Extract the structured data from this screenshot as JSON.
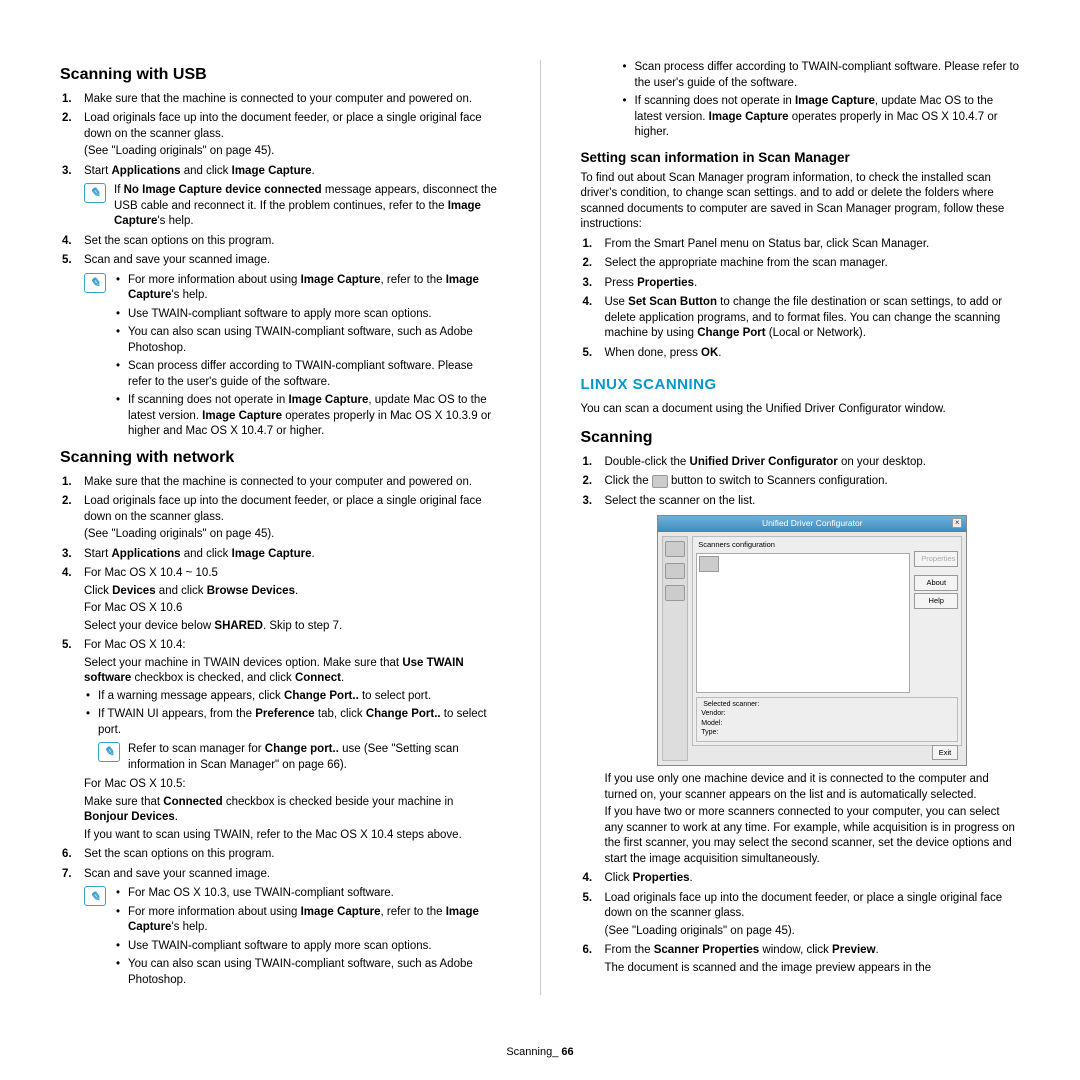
{
  "footer": {
    "label": "Scanning_",
    "page": "66"
  },
  "col1": {
    "h_usb": "Scanning with USB",
    "usb": {
      "s1": "Make sure that the machine is connected to your computer and powered on.",
      "s2a": "Load originals face up into the document feeder, or place a single original face down on the scanner glass.",
      "s2b": "(See \"Loading originals\" on page 45).",
      "s3_pre": "Start ",
      "s3_b1": "Applications",
      "s3_mid": " and click ",
      "s3_b2": "Image Capture",
      "s3_post": ".",
      "s3_note_pre": "If ",
      "s3_note_b1": "No Image Capture device connected",
      "s3_note_mid": " message appears, disconnect the USB cable and reconnect it. If the problem continues, refer to the ",
      "s3_note_b2": "Image Capture",
      "s3_note_post": "'s help.",
      "s4": "Set the scan options on this program.",
      "s5": "Scan and save your scanned image.",
      "nb1_pre": "For more information about using ",
      "nb1_b1": "Image Capture",
      "nb1_mid": ", refer to the ",
      "nb1_b2": "Image Capture",
      "nb1_post": "'s help.",
      "nb2": "Use TWAIN-compliant software to apply more scan options.",
      "nb3": "You can also scan using TWAIN-compliant software, such as Adobe Photoshop.",
      "nb4": "Scan process differ according to TWAIN-compliant software. Please refer to the user's guide of the software.",
      "nb5_pre": "If scanning does not operate in ",
      "nb5_b1": "Image Capture",
      "nb5_mid": ", update Mac OS to the latest version. ",
      "nb5_b2": "Image Capture",
      "nb5_post": " operates properly in Mac OS X 10.3.9 or higher and Mac OS X 10.4.7 or higher."
    },
    "h_net": "Scanning with network",
    "net": {
      "s1": "Make sure that the machine is connected to your computer and powered on.",
      "s2a": "Load originals face up into the document feeder, or place a single original face down on the scanner glass.",
      "s2b": "(See \"Loading originals\" on page 45).",
      "s3_pre": "Start ",
      "s3_b1": "Applications",
      "s3_mid": " and click ",
      "s3_b2": "Image Capture",
      "s3_post": ".",
      "s4a": "For Mac OS X 10.4 ~ 10.5",
      "s4b_pre": "Click ",
      "s4b_b1": "Devices",
      "s4b_mid": " and click ",
      "s4b_b2": "Browse Devices",
      "s4b_post": ".",
      "s4c": "For Mac OS X 10.6",
      "s4d_pre": "Select your device below ",
      "s4d_b": "SHARED",
      "s4d_post": ". Skip to step 7.",
      "s5a": "For Mac OS X 10.4:",
      "s5b_pre": "Select your machine in TWAIN devices option. Make sure that ",
      "s5b_b1": "Use TWAIN software",
      "s5b_mid": " checkbox is checked, and click ",
      "s5b_b2": "Connect",
      "s5b_post": ".",
      "s5_bul1_pre": "If a warning message appears, click ",
      "s5_bul1_b": "Change Port..",
      "s5_bul1_post": " to select port.",
      "s5_bul2_pre": "If TWAIN UI appears, from the ",
      "s5_bul2_b1": "Preference",
      "s5_bul2_mid": " tab, click ",
      "s5_bul2_b2": "Change Port..",
      "s5_bul2_post": " to select port.",
      "s5_note_pre": "Refer to scan manager for ",
      "s5_note_b": "Change port..",
      "s5_note_post": " use (See \"Setting scan information in Scan Manager\" on page 66).",
      "s5c": "For Mac OS X 10.5:",
      "s5d_pre": "Make sure that ",
      "s5d_b1": "Connected",
      "s5d_mid": " checkbox is checked beside your machine in ",
      "s5d_b2": "Bonjour Devices",
      "s5d_post": ".",
      "s5e": "If you want to scan using TWAIN, refer to the Mac OS X 10.4 steps above.",
      "s6": "Set the scan options on this program.",
      "s7": "Scan and save your scanned image.",
      "nb0": "For Mac OS X 10.3, use TWAIN-compliant software.",
      "nb1_pre": "For more information about using ",
      "nb1_b1": "Image Capture",
      "nb1_mid": ", refer to the ",
      "nb1_b2": "Image Capture",
      "nb1_post": "'s help.",
      "nb2": "Use TWAIN-compliant software to apply more scan options.",
      "nb3": "You can also scan using TWAIN-compliant software, such as Adobe Photoshop."
    }
  },
  "col2": {
    "top_b1": "Scan process differ according to TWAIN-compliant software. Please refer to the user's guide of the software.",
    "top_b2_pre": "If scanning does not operate in ",
    "top_b2_b1": "Image Capture",
    "top_b2_mid": ", update Mac OS to the latest version. ",
    "top_b2_b2": "Image Capture",
    "top_b2_post": " operates properly in Mac OS X 10.4.7 or higher.",
    "h_set": "Setting scan information in Scan Manager",
    "set_intro": "To find out about Scan Manager program information, to check the installed scan driver's condition, to change scan settings. and to add or delete the folders where scanned documents to computer are saved in Scan Manager program, follow these instructions:",
    "set1": "From the Smart Panel menu on Status bar, click Scan Manager.",
    "set2": "Select the appropriate machine from the scan manager.",
    "set3_pre": "Press ",
    "set3_b": "Properties",
    "set3_post": ".",
    "set4_pre": "Use ",
    "set4_b1": "Set Scan Button",
    "set4_mid": " to change the file destination or scan settings, to add or delete application programs, and to format files. You can change the scanning machine by using ",
    "set4_b2": "Change Port",
    "set4_post": " (Local or Network).",
    "set5_pre": "When done, press ",
    "set5_b": "OK",
    "set5_post": ".",
    "h_linux": "LINUX SCANNING",
    "linux_intro": "You can scan a document using the Unified Driver Configurator window.",
    "h_scan": "Scanning",
    "sc1_pre": "Double-click the ",
    "sc1_b": "Unified Driver Configurator",
    "sc1_post": " on your desktop.",
    "sc2_pre": "Click the ",
    "sc2_post": " button to switch to Scanners configuration.",
    "sc3": "Select the scanner on the list.",
    "dlg": {
      "title": "Unified Driver Configurator",
      "fs": "Scanners configuration",
      "prop": "Properties",
      "about": "About",
      "help": "Help",
      "sel": "Selected scanner:",
      "vendor": "Vendor:",
      "model": "Model:",
      "type": "Type:",
      "exit": "Exit"
    },
    "after1": "If you use only one machine device and it is connected to the computer and turned on, your scanner appears on the list and is automatically selected.",
    "after2": "If you have two or more scanners connected to your computer, you can select any scanner to work at any time. For example, while acquisition is in progress on the first scanner, you may select the second scanner, set the device options and start the image acquisition simultaneously.",
    "sc4_pre": "Click ",
    "sc4_b": "Properties",
    "sc4_post": ".",
    "sc5a": "Load originals face up into the document feeder, or place a single original face down on the scanner glass.",
    "sc5b": "(See \"Loading originals\" on page 45).",
    "sc6_pre": "From the ",
    "sc6_b1": "Scanner Properties",
    "sc6_mid": " window, click ",
    "sc6_b2": "Preview",
    "sc6_post": ".",
    "sc6_after": "The document is scanned and the image preview appears in the"
  }
}
